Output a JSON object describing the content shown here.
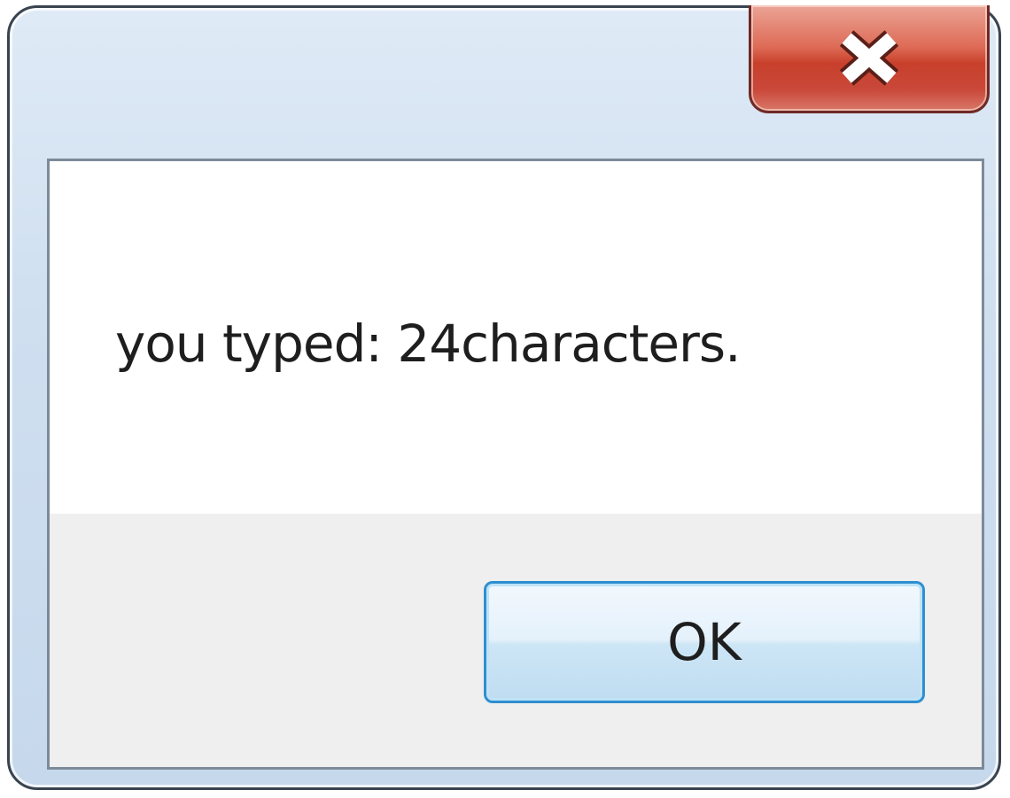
{
  "dialog": {
    "message": "you typed: 24characters.",
    "ok_label": "OK",
    "close_icon": "close-icon"
  },
  "colors": {
    "frame": "#cfdff0",
    "close_button": "#c8402b",
    "ok_focus_border": "#2f8fd0",
    "button_area": "#efefef"
  }
}
